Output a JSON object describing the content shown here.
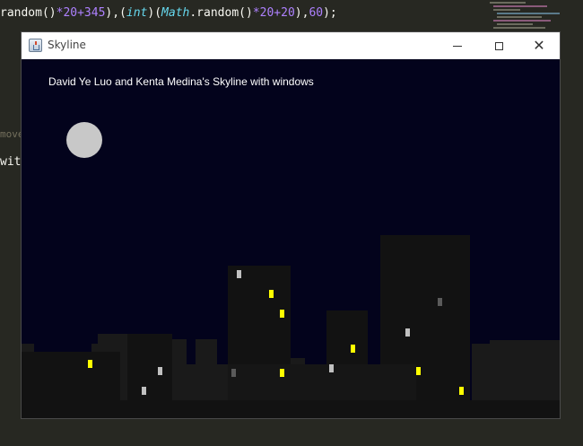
{
  "editor": {
    "line1": {
      "p1": "random()",
      "p2": "*20+345",
      "p3": "),(",
      "p4": "int",
      "p5": ")(",
      "p6": "Math",
      "p7": ".random()",
      "p8": "*20+20",
      "p9": "),",
      "p10": "60",
      "p11": ");"
    },
    "line2": "move",
    "line3": "wit"
  },
  "window": {
    "title": "Skyline",
    "minimize_icon": "minimize-icon",
    "maximize_icon": "maximize-icon",
    "close_icon": "close-icon",
    "close_glyph": "✕"
  },
  "scene": {
    "caption": "David Ye Luo and Kenta Medina's Skyline with windows",
    "sky_color": "#03031c",
    "moon_color": "#c8c8c8",
    "building_colors": [
      "#121212",
      "#1a1a1a",
      "#161616"
    ],
    "window_colors": {
      "yellow": "#ffff00",
      "white": "#c0c0c0",
      "gray": "#5a5a5a"
    }
  }
}
